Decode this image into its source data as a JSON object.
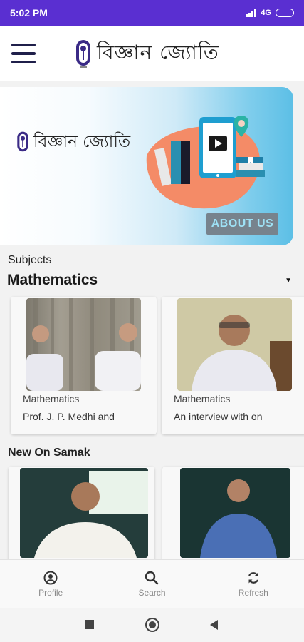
{
  "status_bar": {
    "time": "5:02 PM",
    "network": "4G"
  },
  "app_bar": {
    "brand_name": "বিজ্ঞান জ্যোতি",
    "menu_icon": "hamburger-menu-icon"
  },
  "banner": {
    "brand_name": "বিজ্ঞান জ্যোতি",
    "about_label": "ABOUT US"
  },
  "subjects": {
    "label": "Subjects",
    "selected": "Mathematics"
  },
  "subject_cards": [
    {
      "subject": "Mathematics",
      "title": "Prof. J. P. Medhi and"
    },
    {
      "subject": "Mathematics",
      "title": "An interview with on"
    }
  ],
  "new_on_samak": {
    "label": "New On Samak"
  },
  "bottom_nav": [
    {
      "label": "Profile",
      "icon": "profile-icon"
    },
    {
      "label": "Search",
      "icon": "search-icon"
    },
    {
      "label": "Refresh",
      "icon": "refresh-icon"
    }
  ],
  "colors": {
    "status_bar": "#5a2fd1",
    "banner_accent": "#5cbfe6",
    "about_button": "#77838d"
  }
}
